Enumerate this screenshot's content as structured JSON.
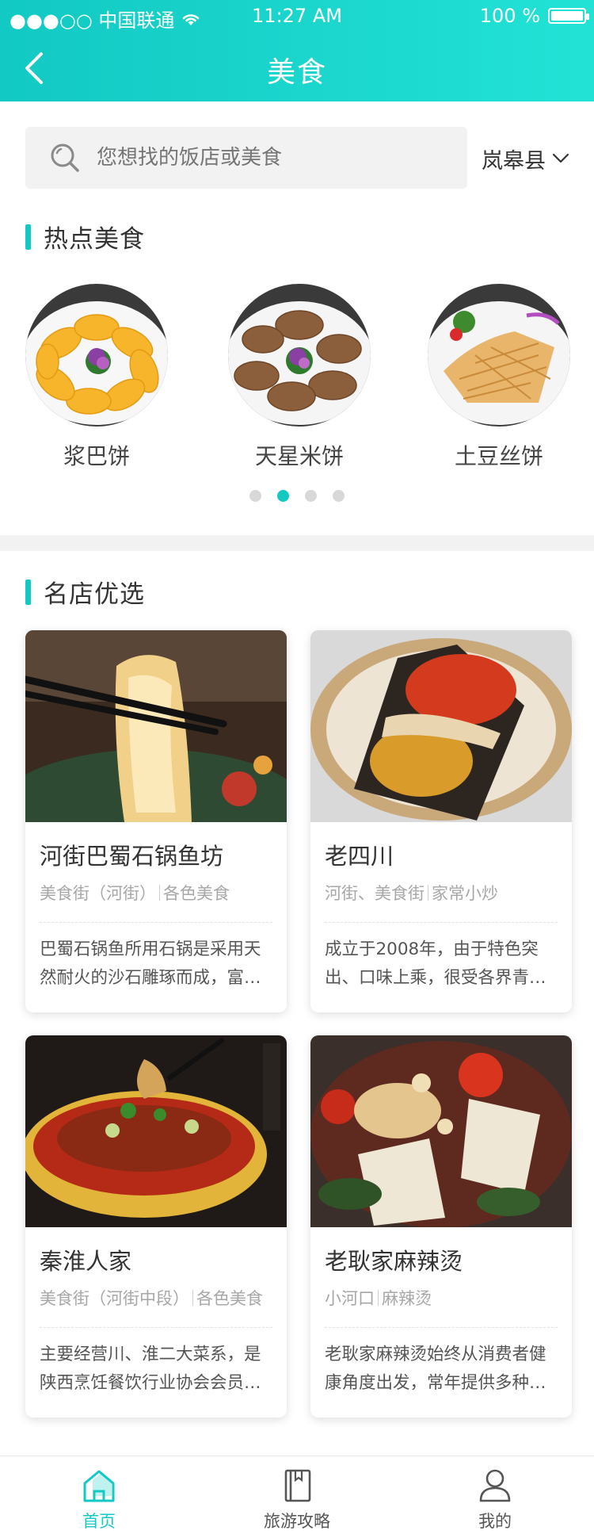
{
  "status_bar": {
    "carrier": "●●●○○ 中国联通",
    "time": "11:27 AM",
    "battery": "100 %"
  },
  "nav": {
    "title": "美食",
    "back_icon": "chevron-left-icon"
  },
  "search": {
    "placeholder": "您想找的饭店或美食",
    "location": "岚皋县"
  },
  "hot_food": {
    "title": "热点美食",
    "items": [
      {
        "label": "浆巴饼"
      },
      {
        "label": "天星米饼"
      },
      {
        "label": "土豆丝饼"
      }
    ],
    "page_count": 4,
    "active_page": 2
  },
  "shops": {
    "title": "名店优选",
    "items": [
      {
        "name": "河街巴蜀石锅鱼坊",
        "tag1": "美食街（河街）",
        "tag2": "各色美食",
        "desc": "巴蜀石锅鱼所用石锅是采用天然耐火的沙石雕琢而成，富…"
      },
      {
        "name": "老四川",
        "tag1": "河街、美食街",
        "tag2": "家常小炒",
        "desc": "成立于2008年，由于特色突出、口味上乘，很受各界青…"
      },
      {
        "name": "秦淮人家",
        "tag1": "美食街（河街中段）",
        "tag2": "各色美食",
        "desc": "主要经营川、淮二大菜系，是陕西烹饪餐饮行业协会会员…"
      },
      {
        "name": "老耿家麻辣烫",
        "tag1": "小河口",
        "tag2": "麻辣烫",
        "desc": "老耿家麻辣烫始终从消费者健康角度出发，常年提供多种…"
      }
    ]
  },
  "tab_bar": {
    "items": [
      {
        "label": "首页",
        "icon": "home-icon"
      },
      {
        "label": "旅游攻略",
        "icon": "book-icon"
      },
      {
        "label": "我的",
        "icon": "user-icon"
      }
    ],
    "accent": "#14c9c3"
  }
}
